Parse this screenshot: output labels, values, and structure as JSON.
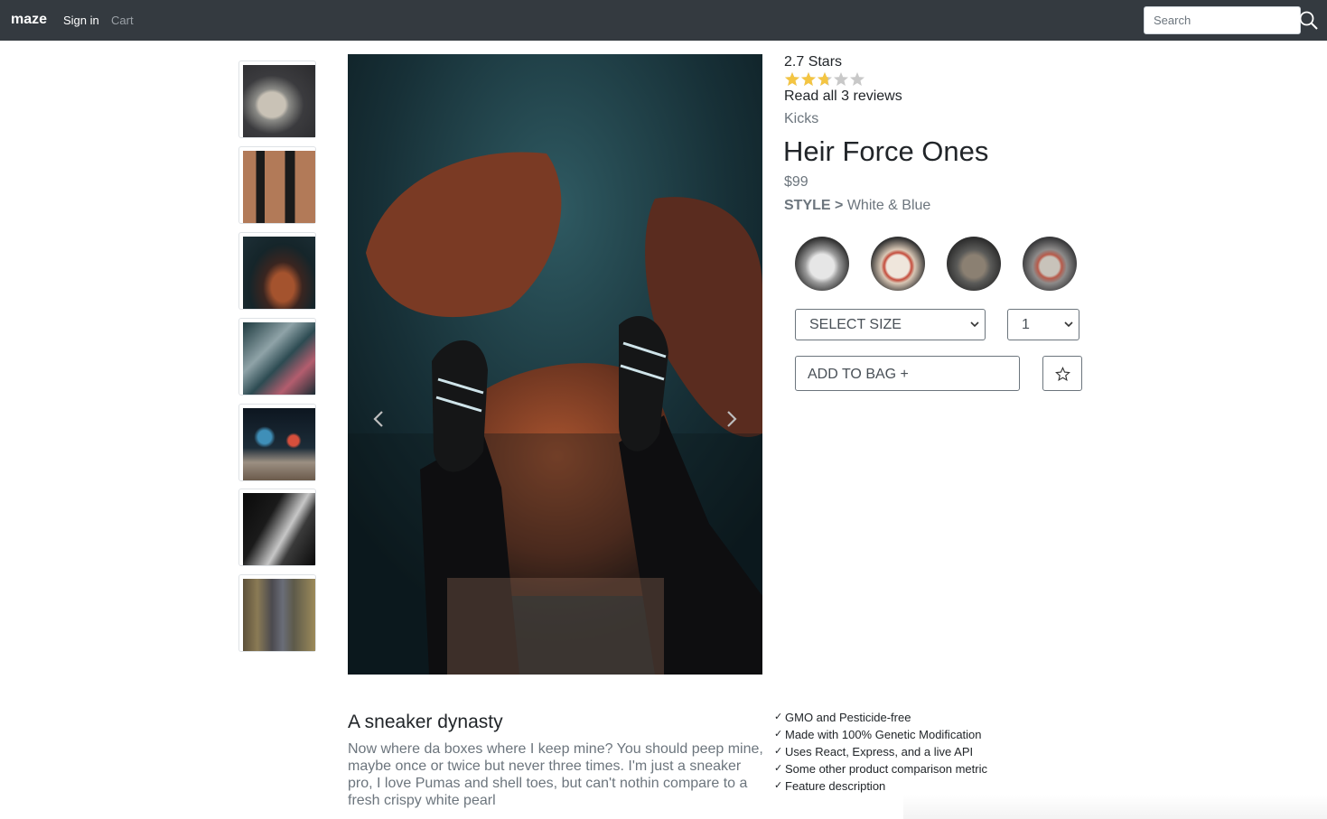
{
  "navbar": {
    "brand": "maze",
    "sign_in": "Sign in",
    "cart": "Cart",
    "search_placeholder": "Search",
    "background": "#343a40"
  },
  "thumbnails": [
    {
      "name": "thumb-1",
      "icon": "sneaker-photo"
    },
    {
      "name": "thumb-2",
      "icon": "sneaker-photo"
    },
    {
      "name": "thumb-3",
      "icon": "sneaker-photo"
    },
    {
      "name": "thumb-4",
      "icon": "sneaker-photo"
    },
    {
      "name": "thumb-5",
      "icon": "sneaker-photo"
    },
    {
      "name": "thumb-6",
      "icon": "sneaker-photo"
    },
    {
      "name": "thumb-7",
      "icon": "sneaker-photo"
    }
  ],
  "carousel": {
    "prev_icon": "chevron-left-icon",
    "next_icon": "chevron-right-icon"
  },
  "product": {
    "rating_text": "2.7 Stars",
    "rating_value": 2.7,
    "rating_max": 5,
    "reviews_link": "Read all 3 reviews",
    "category": "Kicks",
    "name": "Heir Force Ones",
    "price": "$99",
    "style_label": "STYLE",
    "style_arrow": ">",
    "style_value": "White & Blue",
    "size_select": "SELECT SIZE",
    "quantity": "1",
    "add_to_bag": "ADD TO BAG +",
    "star_color": "#f4c542"
  },
  "description": {
    "title": "A sneaker dynasty",
    "body": "Now where da boxes where I keep mine? You should peep mine, maybe once or twice but never three times. I'm just a sneaker pro, I love Pumas and shell toes, but can't nothin compare to a fresh crispy white pearl",
    "features": [
      "GMO and Pesticide-free",
      "Made with 100% Genetic Modification",
      "Uses React, Express, and a live API",
      "Some other product comparison metric",
      "Feature description"
    ]
  }
}
